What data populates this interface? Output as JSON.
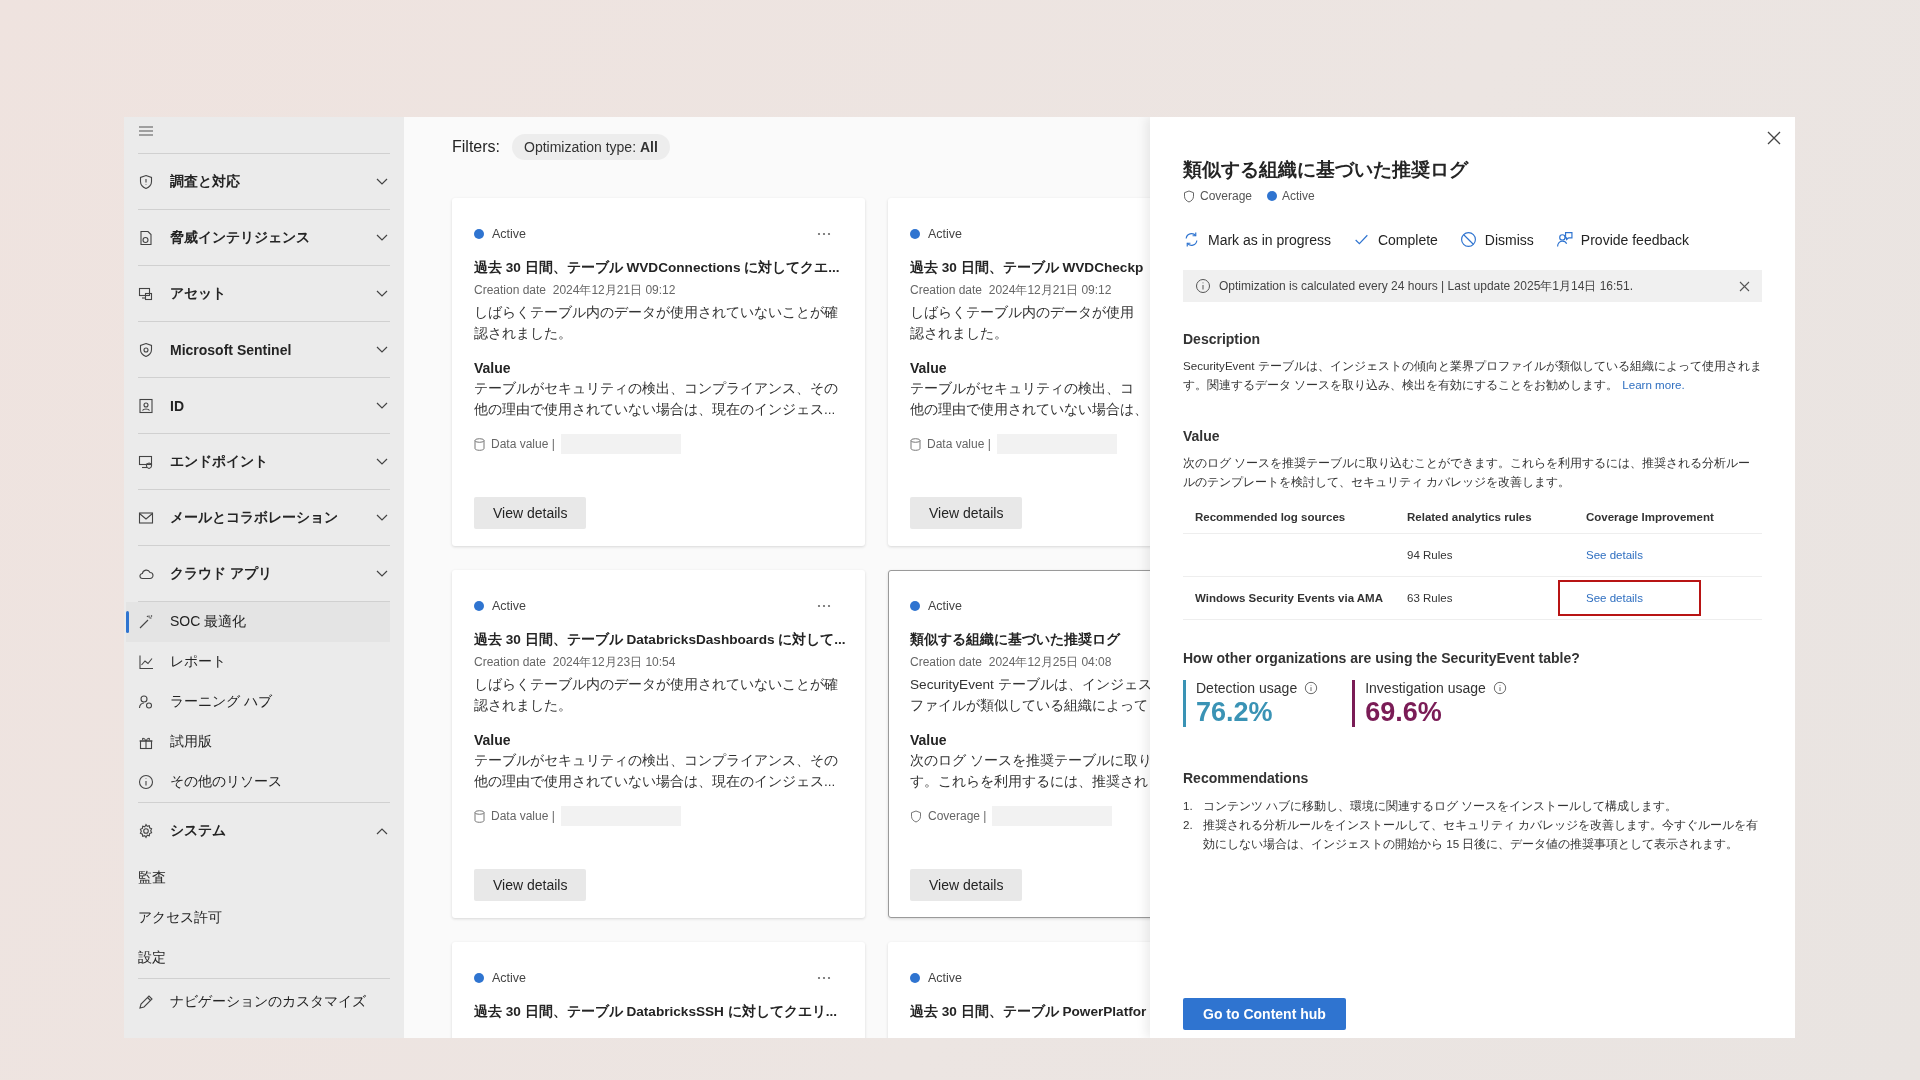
{
  "sidebar": {
    "items": [
      {
        "label": "調査と対応",
        "kind": "group",
        "expanded": false
      },
      {
        "label": "脅威インテリジェンス",
        "kind": "group",
        "expanded": false
      },
      {
        "label": "アセット",
        "kind": "group",
        "expanded": false
      },
      {
        "label": "Microsoft Sentinel",
        "kind": "group",
        "expanded": false
      },
      {
        "label": "ID",
        "kind": "group",
        "expanded": false
      },
      {
        "label": "エンドポイント",
        "kind": "group",
        "expanded": false
      },
      {
        "label": "メールとコラボレーション",
        "kind": "group",
        "expanded": false
      },
      {
        "label": "クラウド アプリ",
        "kind": "group",
        "expanded": false
      },
      {
        "label": "SOC 最適化",
        "kind": "link",
        "selected": true
      },
      {
        "label": "レポート",
        "kind": "link",
        "selected": false
      },
      {
        "label": "ラーニング ハブ",
        "kind": "link",
        "selected": false
      },
      {
        "label": "試用版",
        "kind": "link",
        "selected": false
      },
      {
        "label": "その他のリソース",
        "kind": "link",
        "selected": false
      },
      {
        "label": "システム",
        "kind": "group",
        "expanded": true,
        "children": [
          {
            "label": "監査"
          },
          {
            "label": "アクセス許可"
          },
          {
            "label": "設定"
          }
        ]
      },
      {
        "label": "ナビゲーションのカスタマイズ",
        "kind": "action"
      }
    ]
  },
  "filters": {
    "label": "Filters:",
    "chip": "Optimization type: **All**"
  },
  "cards": [
    {
      "status": "Active",
      "selected": false,
      "title": "過去 30 日間、テーブル WVDConnections に対してクエ...",
      "date_label": "Creation date",
      "date": "2024年12月21日 09:12",
      "description": [
        "しばらくテーブル内のデータが使用されていないことが確",
        "認されました。"
      ],
      "value_label": "Value",
      "value": [
        "テーブルがセキュリティの検出、コンプライアンス、その",
        "他の理由で使用されていない場合は、現在のインジェス..."
      ],
      "footer": {
        "kind": "data",
        "label": "Data value |"
      },
      "button": "View details"
    },
    {
      "status": "Active",
      "selected": false,
      "title": "過去 30 日間、テーブル WVDCheckp",
      "date_label": "Creation date",
      "date": "2024年12月21日 09:12",
      "description": [
        "しばらくテーブル内のデータが使用",
        "認されました。"
      ],
      "value_label": "Value",
      "value": [
        "テーブルがセキュリティの検出、コ",
        "他の理由で使用されていない場合は、"
      ],
      "footer": {
        "kind": "data",
        "label": "Data value |"
      },
      "button": "View details"
    },
    {
      "status": "Active",
      "selected": false,
      "title": "過去 30 日間、テーブル DatabricksDashboards に対して...",
      "date_label": "Creation date",
      "date": "2024年12月23日 10:54",
      "description": [
        "しばらくテーブル内のデータが使用されていないことが確",
        "認されました。"
      ],
      "value_label": "Value",
      "value": [
        "テーブルがセキュリティの検出、コンプライアンス、その",
        "他の理由で使用されていない場合は、現在のインジェス..."
      ],
      "footer": {
        "kind": "data",
        "label": "Data value |"
      },
      "button": "View details"
    },
    {
      "status": "Active",
      "selected": true,
      "title": "類似する組織に基づいた推奨ログ",
      "date_label": "Creation date",
      "date": "2024年12月25日 04:08",
      "description": [
        "SecurityEvent テーブルは、インジェス",
        "ファイルが類似している組織によって"
      ],
      "value_label": "Value",
      "value": [
        "次のログ ソースを推奨テーブルに取り",
        "す。これらを利用するには、推奨され"
      ],
      "footer": {
        "kind": "coverage",
        "label": "Coverage |"
      },
      "button": "View details"
    },
    {
      "status": "Active",
      "selected": false,
      "title": "過去 30 日間、テーブル DatabricksSSH に対してクエリ..."
    },
    {
      "status": "Active",
      "selected": false,
      "title": "過去 30 日間、テーブル PowerPlatfor"
    }
  ],
  "panel": {
    "title": "類似する組織に基づいた推奨ログ",
    "type": "Coverage",
    "status": "Active",
    "actions": [
      "Mark as in progress",
      "Complete",
      "Dismiss",
      "Provide feedback"
    ],
    "info": "Optimization is calculated every 24 hours | Last update 2025年1月14日 16:51.",
    "description_heading": "Description",
    "description": "SecurityEvent テーブルは、インジェストの傾向と業界プロファイルが類似している組織によって使用されます。関連するデータ ソースを取り込み、検出を有効にすることをお勧めします。",
    "learn_more": "Learn more.",
    "value_heading": "Value",
    "value": "次のログ ソースを推奨テーブルに取り込むことができます。これらを利用するには、推奨される分析ルールのテンプレートを検討して、セキュリティ カバレッジを改善します。",
    "table": {
      "columns": [
        "Recommended log sources",
        "Related analytics rules",
        "Coverage Improvement"
      ],
      "rows": [
        {
          "rules": "94 Rules",
          "link": "See details",
          "highlighted": false
        },
        {
          "source": "Windows Security Events via AMA",
          "rules": "63 Rules",
          "link": "See details",
          "highlighted": true
        }
      ]
    },
    "usage_heading": "How other organizations are using the SecurityEvent table?",
    "usage": [
      {
        "label": "Detection usage",
        "value": "76.2%",
        "color": "#3a93b5"
      },
      {
        "label": "Investigation usage",
        "value": "69.6%",
        "color": "#7a1c56"
      }
    ],
    "recommendations_heading": "Recommendations",
    "recommendations": [
      {
        "number": "1.",
        "text": "コンテンツ ハブに移動し、環境に関連するログ ソースをインストールして構成します。"
      },
      {
        "number": "2.",
        "text": "推奨される分析ルールをインストールして、セキュリティ カバレッジを改善します。今すぐルールを有効にしない場合は、インジェストの開始から 15 日後に、データ値の推奨事項として表示されます。"
      }
    ],
    "primary_button": "Go to Content hub"
  }
}
